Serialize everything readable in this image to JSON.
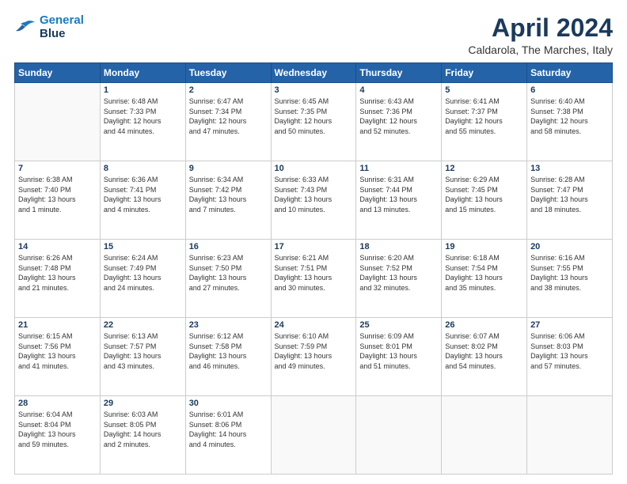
{
  "header": {
    "logo_line1": "General",
    "logo_line2": "Blue",
    "title": "April 2024",
    "subtitle": "Caldarola, The Marches, Italy"
  },
  "weekdays": [
    "Sunday",
    "Monday",
    "Tuesday",
    "Wednesday",
    "Thursday",
    "Friday",
    "Saturday"
  ],
  "weeks": [
    [
      {
        "day": "",
        "info": ""
      },
      {
        "day": "1",
        "info": "Sunrise: 6:48 AM\nSunset: 7:33 PM\nDaylight: 12 hours\nand 44 minutes."
      },
      {
        "day": "2",
        "info": "Sunrise: 6:47 AM\nSunset: 7:34 PM\nDaylight: 12 hours\nand 47 minutes."
      },
      {
        "day": "3",
        "info": "Sunrise: 6:45 AM\nSunset: 7:35 PM\nDaylight: 12 hours\nand 50 minutes."
      },
      {
        "day": "4",
        "info": "Sunrise: 6:43 AM\nSunset: 7:36 PM\nDaylight: 12 hours\nand 52 minutes."
      },
      {
        "day": "5",
        "info": "Sunrise: 6:41 AM\nSunset: 7:37 PM\nDaylight: 12 hours\nand 55 minutes."
      },
      {
        "day": "6",
        "info": "Sunrise: 6:40 AM\nSunset: 7:38 PM\nDaylight: 12 hours\nand 58 minutes."
      }
    ],
    [
      {
        "day": "7",
        "info": "Sunrise: 6:38 AM\nSunset: 7:40 PM\nDaylight: 13 hours\nand 1 minute."
      },
      {
        "day": "8",
        "info": "Sunrise: 6:36 AM\nSunset: 7:41 PM\nDaylight: 13 hours\nand 4 minutes."
      },
      {
        "day": "9",
        "info": "Sunrise: 6:34 AM\nSunset: 7:42 PM\nDaylight: 13 hours\nand 7 minutes."
      },
      {
        "day": "10",
        "info": "Sunrise: 6:33 AM\nSunset: 7:43 PM\nDaylight: 13 hours\nand 10 minutes."
      },
      {
        "day": "11",
        "info": "Sunrise: 6:31 AM\nSunset: 7:44 PM\nDaylight: 13 hours\nand 13 minutes."
      },
      {
        "day": "12",
        "info": "Sunrise: 6:29 AM\nSunset: 7:45 PM\nDaylight: 13 hours\nand 15 minutes."
      },
      {
        "day": "13",
        "info": "Sunrise: 6:28 AM\nSunset: 7:47 PM\nDaylight: 13 hours\nand 18 minutes."
      }
    ],
    [
      {
        "day": "14",
        "info": "Sunrise: 6:26 AM\nSunset: 7:48 PM\nDaylight: 13 hours\nand 21 minutes."
      },
      {
        "day": "15",
        "info": "Sunrise: 6:24 AM\nSunset: 7:49 PM\nDaylight: 13 hours\nand 24 minutes."
      },
      {
        "day": "16",
        "info": "Sunrise: 6:23 AM\nSunset: 7:50 PM\nDaylight: 13 hours\nand 27 minutes."
      },
      {
        "day": "17",
        "info": "Sunrise: 6:21 AM\nSunset: 7:51 PM\nDaylight: 13 hours\nand 30 minutes."
      },
      {
        "day": "18",
        "info": "Sunrise: 6:20 AM\nSunset: 7:52 PM\nDaylight: 13 hours\nand 32 minutes."
      },
      {
        "day": "19",
        "info": "Sunrise: 6:18 AM\nSunset: 7:54 PM\nDaylight: 13 hours\nand 35 minutes."
      },
      {
        "day": "20",
        "info": "Sunrise: 6:16 AM\nSunset: 7:55 PM\nDaylight: 13 hours\nand 38 minutes."
      }
    ],
    [
      {
        "day": "21",
        "info": "Sunrise: 6:15 AM\nSunset: 7:56 PM\nDaylight: 13 hours\nand 41 minutes."
      },
      {
        "day": "22",
        "info": "Sunrise: 6:13 AM\nSunset: 7:57 PM\nDaylight: 13 hours\nand 43 minutes."
      },
      {
        "day": "23",
        "info": "Sunrise: 6:12 AM\nSunset: 7:58 PM\nDaylight: 13 hours\nand 46 minutes."
      },
      {
        "day": "24",
        "info": "Sunrise: 6:10 AM\nSunset: 7:59 PM\nDaylight: 13 hours\nand 49 minutes."
      },
      {
        "day": "25",
        "info": "Sunrise: 6:09 AM\nSunset: 8:01 PM\nDaylight: 13 hours\nand 51 minutes."
      },
      {
        "day": "26",
        "info": "Sunrise: 6:07 AM\nSunset: 8:02 PM\nDaylight: 13 hours\nand 54 minutes."
      },
      {
        "day": "27",
        "info": "Sunrise: 6:06 AM\nSunset: 8:03 PM\nDaylight: 13 hours\nand 57 minutes."
      }
    ],
    [
      {
        "day": "28",
        "info": "Sunrise: 6:04 AM\nSunset: 8:04 PM\nDaylight: 13 hours\nand 59 minutes."
      },
      {
        "day": "29",
        "info": "Sunrise: 6:03 AM\nSunset: 8:05 PM\nDaylight: 14 hours\nand 2 minutes."
      },
      {
        "day": "30",
        "info": "Sunrise: 6:01 AM\nSunset: 8:06 PM\nDaylight: 14 hours\nand 4 minutes."
      },
      {
        "day": "",
        "info": ""
      },
      {
        "day": "",
        "info": ""
      },
      {
        "day": "",
        "info": ""
      },
      {
        "day": "",
        "info": ""
      }
    ]
  ]
}
